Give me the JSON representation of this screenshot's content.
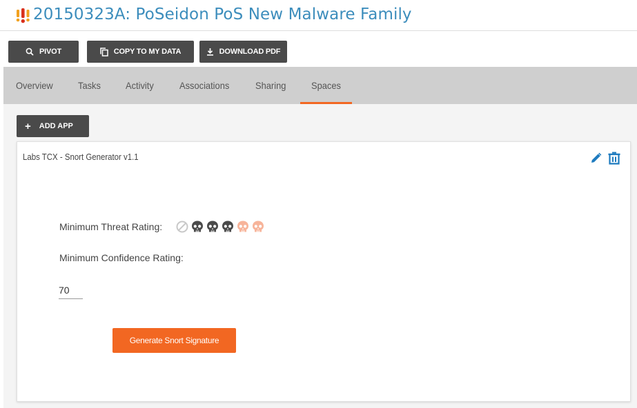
{
  "header": {
    "title": "20150323A: PoSeidon PoS New Malware Family",
    "icon": "threat-level-icon",
    "title_color": "#3c8dbc"
  },
  "toolbar": {
    "pivot_label": "PIVOT",
    "copy_label": "COPY TO MY DATA",
    "download_label": "DOWNLOAD PDF"
  },
  "tabs": {
    "items": [
      {
        "label": "Overview"
      },
      {
        "label": "Tasks"
      },
      {
        "label": "Activity"
      },
      {
        "label": "Associations"
      },
      {
        "label": "Sharing"
      },
      {
        "label": "Spaces"
      }
    ],
    "active": "Spaces",
    "accent_color": "#f26722"
  },
  "spaces": {
    "add_app_label": "ADD APP"
  },
  "app_card": {
    "title": "Labs TCX - Snort Generator v1.1",
    "threat_label": "Minimum Threat Rating:",
    "threat_rating": 3,
    "threat_rating_max": 5,
    "confidence_label": "Minimum Confidence Rating:",
    "confidence_value": "70",
    "generate_label": "Generate Snort Signature"
  }
}
